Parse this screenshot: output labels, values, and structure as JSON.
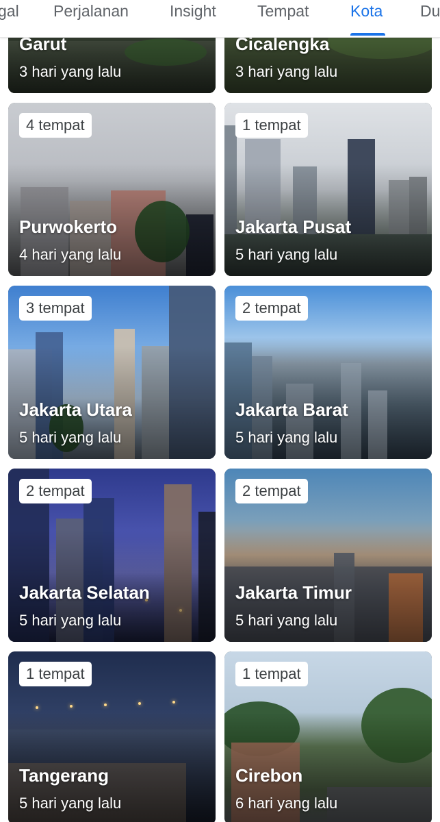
{
  "tabs": [
    {
      "label": "gal",
      "active": false
    },
    {
      "label": "Perjalanan",
      "active": false
    },
    {
      "label": "Insight",
      "active": false
    },
    {
      "label": "Tempat",
      "active": false
    },
    {
      "label": "Kota",
      "active": true
    },
    {
      "label": "Du",
      "active": false
    }
  ],
  "cards": [
    {
      "city": "Garut",
      "time": "3 hari yang lalu",
      "badge": ""
    },
    {
      "city": "Cicalengka",
      "time": "3 hari yang lalu",
      "badge": ""
    },
    {
      "city": "Purwokerto",
      "time": "4 hari yang lalu",
      "badge": "4 tempat"
    },
    {
      "city": "Jakarta Pusat",
      "time": "5 hari yang lalu",
      "badge": "1 tempat"
    },
    {
      "city": "Jakarta Utara",
      "time": "5 hari yang lalu",
      "badge": "3 tempat"
    },
    {
      "city": "Jakarta Barat",
      "time": "5 hari yang lalu",
      "badge": "2 tempat"
    },
    {
      "city": "Jakarta Selatan",
      "time": "5 hari yang lalu",
      "badge": "2 tempat"
    },
    {
      "city": "Jakarta Timur",
      "time": "5 hari yang lalu",
      "badge": "2 tempat"
    },
    {
      "city": "Tangerang",
      "time": "5 hari yang lalu",
      "badge": "1 tempat"
    },
    {
      "city": "Cirebon",
      "time": "6 hari yang lalu",
      "badge": "1 tempat"
    }
  ],
  "colors": {
    "accent": "#1a73e8",
    "tab_text": "#5f6368"
  }
}
